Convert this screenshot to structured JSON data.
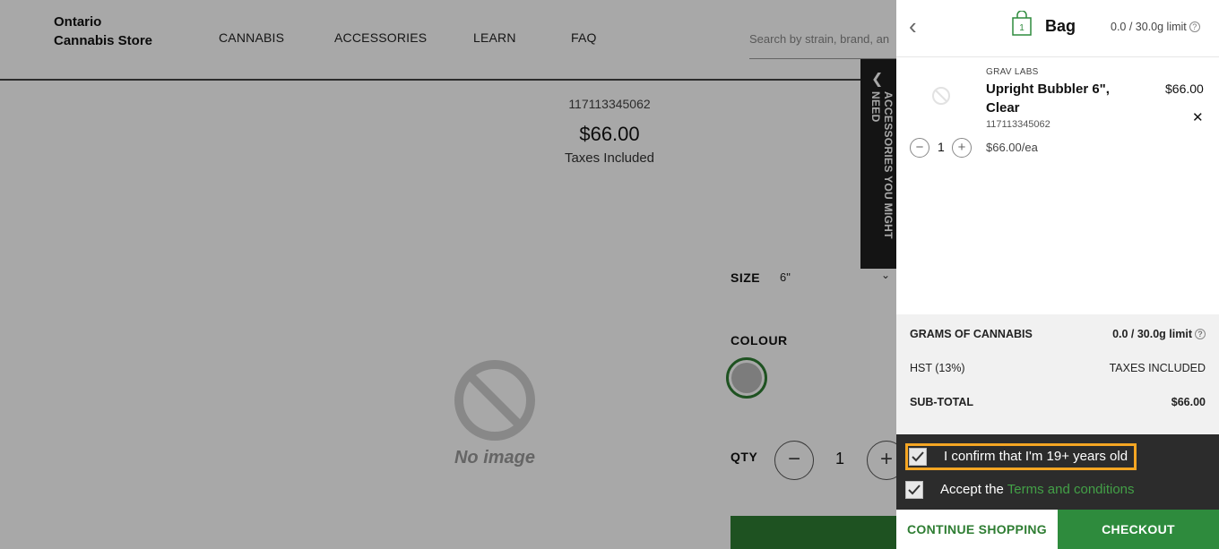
{
  "header": {
    "brand_line1": "Ontario",
    "brand_line2": "Cannabis Store",
    "nav": [
      "CANNABIS",
      "ACCESSORIES",
      "LEARN",
      "FAQ"
    ],
    "search_placeholder": "Search by strain, brand, an"
  },
  "product": {
    "sku": "117113345062",
    "price": "$66.00",
    "tax_note": "Taxes Included",
    "no_image": "No image",
    "size_label": "SIZE",
    "size_value": "6\"",
    "colour_label": "COLOUR",
    "qty_label": "QTY",
    "qty_value": "1",
    "qty_minus": "−",
    "qty_plus": "+"
  },
  "side_tab": {
    "label": "ACCESSORIES YOU MIGHT NEED"
  },
  "bag": {
    "title": "Bag",
    "count": "1",
    "limit": "0.0 / 30.0g limit",
    "help": "?",
    "item": {
      "brand": "GRAV LABS",
      "name": "Upright Bubbler 6\", Clear",
      "sku": "117113345062",
      "price": "$66.00",
      "remove": "✕",
      "qty": "1",
      "each": "$66.00/ea",
      "minus": "−",
      "plus": "+"
    },
    "summary": {
      "grams_label": "GRAMS OF CANNABIS",
      "grams_value": "0.0 / 30.0g limit",
      "hst_label": "HST (13%)",
      "hst_value": "TAXES INCLUDED",
      "subtotal_label": "SUB-TOTAL",
      "subtotal_value": "$66.00"
    },
    "confirm_age": "I confirm that I'm 19+ years old",
    "accept_prefix": "Accept the ",
    "terms_link": "Terms and conditions",
    "continue_btn": "CONTINUE SHOPPING",
    "checkout_btn": "CHECKOUT"
  },
  "colors": {
    "accent_green": "#2e7d32",
    "focus_orange": "#f5a623",
    "dark_panel": "#2c2c2c"
  }
}
